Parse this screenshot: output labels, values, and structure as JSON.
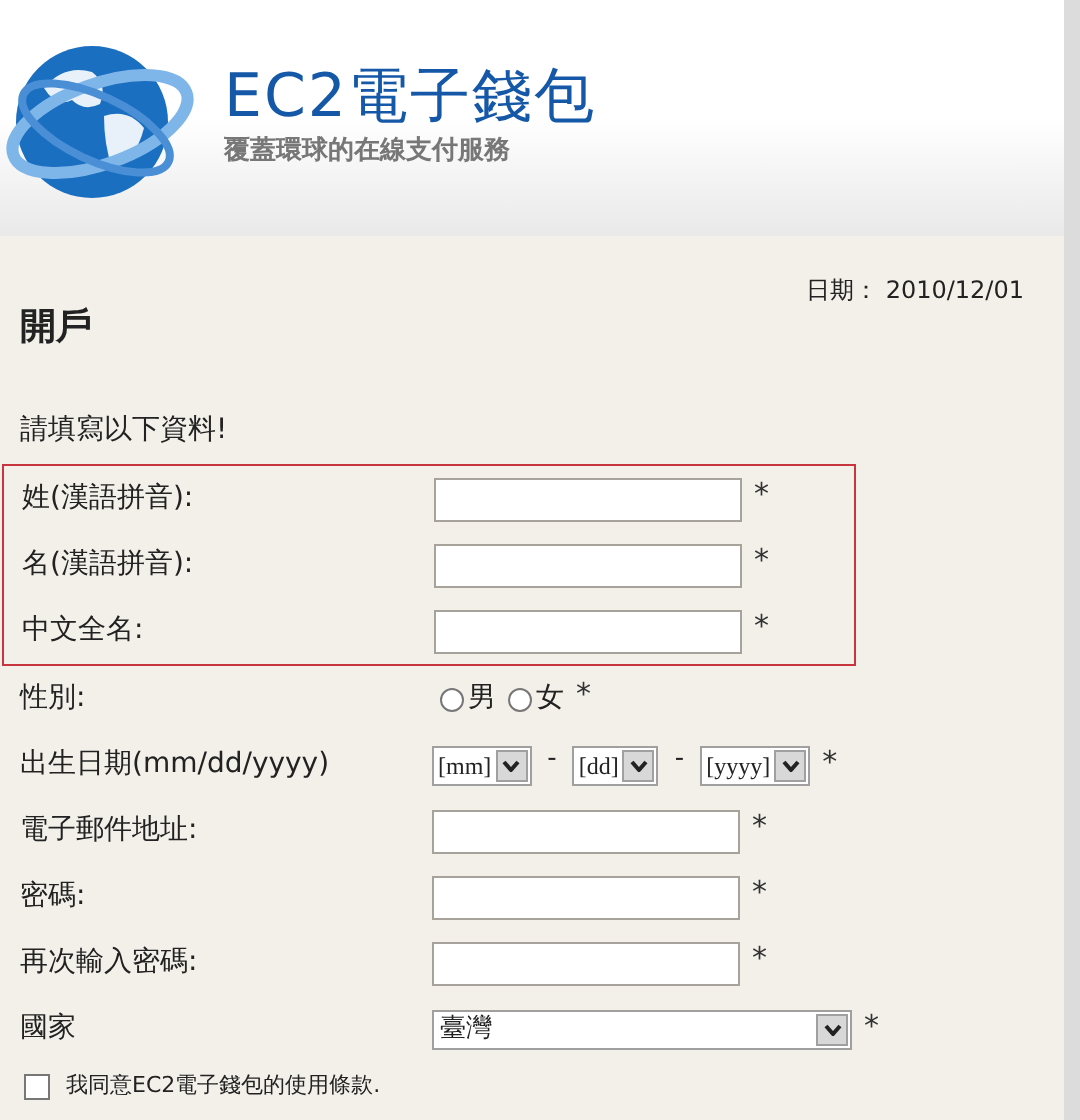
{
  "header": {
    "title": "EC2電子錢包",
    "subtitle": "覆蓋環球的在線支付服務"
  },
  "date": "日期： 2010/12/01",
  "heading": "開戶",
  "instruction": "請填寫以下資料!",
  "highlighted_fields": [
    {
      "kind": "text",
      "label": "姓(漢語拼音):",
      "mark": "*"
    },
    {
      "kind": "text",
      "label": "名(漢語拼音):",
      "mark": "*"
    },
    {
      "kind": "text",
      "label": "中文全名:",
      "mark": "*"
    }
  ],
  "fields": [
    {
      "kind": "radio",
      "label": "性別:",
      "options": [
        {
          "label": "男",
          "selected": false
        },
        {
          "label": "女",
          "selected": false
        }
      ],
      "mark": "*"
    },
    {
      "kind": "date",
      "label": "出生日期(mm/dd/yyyy)",
      "parts": [
        {
          "kind": "select",
          "value": "[mm]"
        },
        {
          "kind": "sep",
          "text": "-"
        },
        {
          "kind": "select",
          "value": "[dd]"
        },
        {
          "kind": "sep",
          "text": "-"
        },
        {
          "kind": "select",
          "value": "[yyyy]"
        }
      ],
      "mark": "*"
    },
    {
      "kind": "text",
      "label": "電子郵件地址:",
      "mark": "*"
    },
    {
      "kind": "text",
      "label": "密碼:",
      "mark": "*"
    },
    {
      "kind": "text",
      "label": "再次輸入密碼:",
      "mark": "*"
    },
    {
      "kind": "select",
      "label": "國家",
      "value": "臺灣",
      "mark": "*"
    }
  ],
  "agreement": {
    "label": "我同意EC2電子錢包的使用條款.",
    "checked": false
  }
}
